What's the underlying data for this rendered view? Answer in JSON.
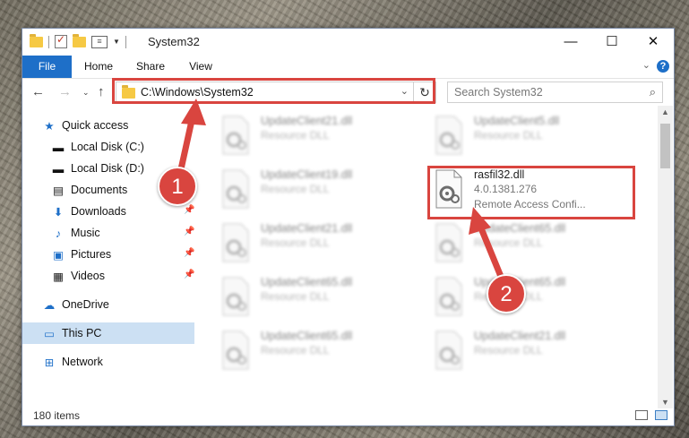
{
  "window": {
    "title": "System32"
  },
  "ribbon": {
    "tabs": [
      "File",
      "Home",
      "Share",
      "View"
    ]
  },
  "address": {
    "path": "C:\\Windows\\System32"
  },
  "search": {
    "placeholder": "Search System32"
  },
  "sidebar": {
    "items": [
      {
        "label": "Quick access",
        "icon": "star-icon"
      },
      {
        "label": "Local Disk (C:)",
        "icon": "drive-icon"
      },
      {
        "label": "Local Disk (D:)",
        "icon": "drive-icon"
      },
      {
        "label": "Documents",
        "icon": "documents-icon"
      },
      {
        "label": "Downloads",
        "icon": "downloads-icon"
      },
      {
        "label": "Music",
        "icon": "music-icon"
      },
      {
        "label": "Pictures",
        "icon": "pictures-icon"
      },
      {
        "label": "Videos",
        "icon": "videos-icon"
      },
      {
        "label": "OneDrive",
        "icon": "cloud-icon"
      },
      {
        "label": "This PC",
        "icon": "computer-icon"
      },
      {
        "label": "Network",
        "icon": "network-icon"
      }
    ]
  },
  "files": [
    {
      "name": "UpdateClient21.dll",
      "type": "Resource DLL"
    },
    {
      "name": "UpdateClient5.dll",
      "type": "Resource DLL"
    },
    {
      "name": "UpdateClient19.dll",
      "type": "Resource DLL"
    },
    {
      "name": "rasfil32.dll",
      "version": "4.0.1381.276",
      "description": "Remote Access Confi..."
    },
    {
      "name": "UpdateClient21.dll",
      "type": "Resource DLL"
    },
    {
      "name": "UpdateClient65.dll",
      "type": "Resource DLL"
    },
    {
      "name": "UpdateClient65.dll",
      "type": "Resource DLL"
    },
    {
      "name": "UpdateClient65.dll",
      "type": "Resource DLL"
    },
    {
      "name": "UpdateClient65.dll",
      "type": "Resource DLL"
    },
    {
      "name": "UpdateClient21.dll",
      "type": "Resource DLL"
    }
  ],
  "status": {
    "item_count": "180 items"
  },
  "markers": [
    "1",
    "2"
  ],
  "colors": {
    "accent": "#1e6fc8",
    "highlight": "#d9453f"
  }
}
